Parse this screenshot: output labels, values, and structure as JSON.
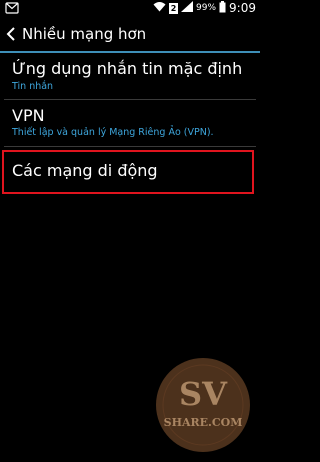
{
  "status_bar": {
    "sim_slot": "2",
    "battery_percent": "99%",
    "time": "9:09",
    "icons": [
      "notification-icon",
      "wifi-icon",
      "sim-icon",
      "signal-icon",
      "battery-icon"
    ]
  },
  "header": {
    "title": "Nhiều mạng hơn",
    "back_icon": "chevron-left-icon"
  },
  "items": [
    {
      "title": "Ứng dụng nhắn tin mặc định",
      "summary": "Tin nhắn"
    },
    {
      "title": "VPN",
      "summary": "Thiết lập và quản lý Mạng Riêng Ảo (VPN)."
    },
    {
      "title": "Các mạng di động",
      "summary": ""
    }
  ],
  "watermark": {
    "top_text": "SV",
    "bottom_text": "SHARE.COM"
  },
  "colors": {
    "accent_blue": "#3ea6dc",
    "divider_blue": "#3e8fb8",
    "highlight_red": "#e0141e",
    "background": "#000000",
    "watermark_brown": "#8a5a33"
  }
}
